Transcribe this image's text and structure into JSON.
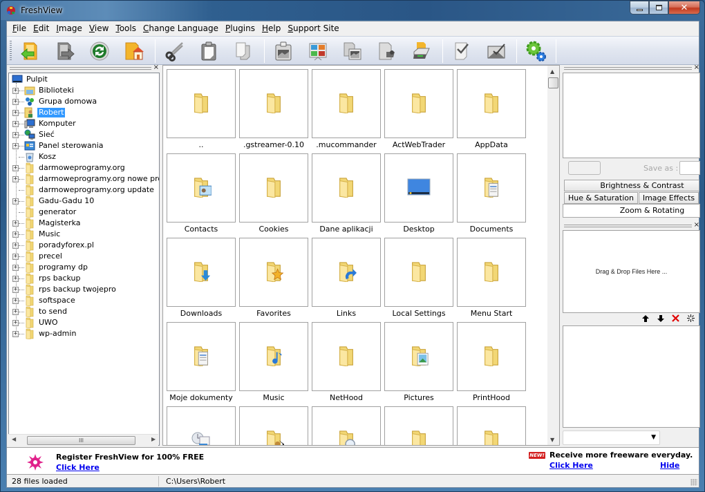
{
  "window": {
    "title": "FreshView",
    "caption_buttons": {
      "minimize": "minimize-icon",
      "maximize": "maximize-icon",
      "close": "close-icon"
    }
  },
  "menu": [
    {
      "label": "File",
      "accel": "F",
      "rest": "ile"
    },
    {
      "label": "Edit",
      "accel": "E",
      "rest": "dit"
    },
    {
      "label": "Image",
      "accel": "I",
      "rest": "mage"
    },
    {
      "label": "View",
      "accel": "V",
      "rest": "iew"
    },
    {
      "label": "Tools",
      "accel": "T",
      "rest": "ools"
    },
    {
      "label": "Change Language",
      "accel": "C",
      "rest": "hange Language"
    },
    {
      "label": "Plugins",
      "accel": "P",
      "rest": "lugins"
    },
    {
      "label": "Help",
      "accel": "H",
      "rest": "elp"
    },
    {
      "label": "Support Site",
      "accel": "S",
      "rest": "upport Site"
    }
  ],
  "toolbar": {
    "buttons": [
      {
        "name": "go-up-folder",
        "icon": "folder-back-icon"
      },
      {
        "name": "forward",
        "icon": "folder-forward-icon"
      },
      {
        "name": "refresh",
        "icon": "refresh-icon"
      },
      {
        "name": "home-folder",
        "icon": "home-folder-icon"
      },
      {
        "name": "cut",
        "icon": "scissors-icon"
      },
      {
        "name": "paste",
        "icon": "clipboard-icon"
      },
      {
        "name": "copy",
        "icon": "copy-icon"
      },
      {
        "name": "paste-image",
        "icon": "clipboard-image-icon"
      },
      {
        "name": "slideshow",
        "icon": "slideshow-icon"
      },
      {
        "name": "batch-convert",
        "icon": "images-stack-icon"
      },
      {
        "name": "scan",
        "icon": "scanner-icon"
      },
      {
        "name": "print",
        "icon": "printer-icon"
      },
      {
        "name": "select-all",
        "icon": "check-page-icon"
      },
      {
        "name": "email",
        "icon": "mail-check-icon"
      },
      {
        "name": "plugins",
        "icon": "gears-icon"
      }
    ]
  },
  "tree": {
    "root": {
      "label": "Pulpit",
      "icon": "desktop-icon"
    },
    "items": [
      {
        "label": "Biblioteki",
        "icon": "libraries-icon",
        "expandable": true,
        "selected": false
      },
      {
        "label": "Grupa domowa",
        "icon": "homegroup-icon",
        "expandable": true,
        "selected": false
      },
      {
        "label": "Robert",
        "icon": "user-folder-icon",
        "expandable": true,
        "selected": true
      },
      {
        "label": "Komputer",
        "icon": "computer-icon",
        "expandable": true,
        "selected": false
      },
      {
        "label": "Sieć",
        "icon": "network-icon",
        "expandable": true,
        "selected": false
      },
      {
        "label": "Panel sterowania",
        "icon": "control-panel-icon",
        "expandable": true,
        "selected": false
      },
      {
        "label": "Kosz",
        "icon": "recycle-bin-icon",
        "expandable": false,
        "selected": false
      },
      {
        "label": "darmoweprogramy.org",
        "icon": "folder-icon",
        "expandable": true,
        "selected": false
      },
      {
        "label": "darmoweprogramy.org nowe programy",
        "icon": "folder-icon",
        "expandable": true,
        "selected": false
      },
      {
        "label": "darmoweprogramy.org update",
        "icon": "folder-icon",
        "expandable": false,
        "selected": false
      },
      {
        "label": "Gadu-Gadu 10",
        "icon": "folder-icon",
        "expandable": true,
        "selected": false
      },
      {
        "label": "generator",
        "icon": "folder-icon",
        "expandable": false,
        "selected": false
      },
      {
        "label": "Magisterka",
        "icon": "folder-icon",
        "expandable": true,
        "selected": false
      },
      {
        "label": "Music",
        "icon": "folder-icon",
        "expandable": true,
        "selected": false
      },
      {
        "label": "poradyforex.pl",
        "icon": "folder-icon",
        "expandable": true,
        "selected": false
      },
      {
        "label": "precel",
        "icon": "folder-icon",
        "expandable": true,
        "selected": false
      },
      {
        "label": "programy dp",
        "icon": "folder-icon",
        "expandable": true,
        "selected": false
      },
      {
        "label": "rps backup",
        "icon": "folder-icon",
        "expandable": true,
        "selected": false
      },
      {
        "label": "rps backup twojepro",
        "icon": "folder-icon",
        "expandable": true,
        "selected": false
      },
      {
        "label": "softspace",
        "icon": "folder-icon",
        "expandable": true,
        "selected": false
      },
      {
        "label": "to send",
        "icon": "folder-icon",
        "expandable": true,
        "selected": false
      },
      {
        "label": "UWO",
        "icon": "folder-icon",
        "expandable": true,
        "selected": false
      },
      {
        "label": "wp-admin",
        "icon": "folder-icon",
        "expandable": true,
        "selected": false
      }
    ],
    "hscroll_thumb_glyph": "III"
  },
  "grid": {
    "items": [
      {
        "label": "..",
        "icon": "folder-icon"
      },
      {
        "label": ".gstreamer-0.10",
        "icon": "folder-icon"
      },
      {
        "label": ".mucommander",
        "icon": "folder-icon"
      },
      {
        "label": "ActWebTrader",
        "icon": "folder-icon"
      },
      {
        "label": "AppData",
        "icon": "folder-icon"
      },
      {
        "label": "Contacts",
        "icon": "contacts-folder-icon"
      },
      {
        "label": "Cookies",
        "icon": "folder-icon"
      },
      {
        "label": "Dane aplikacji",
        "icon": "folder-icon"
      },
      {
        "label": "Desktop",
        "icon": "desktop-icon"
      },
      {
        "label": "Documents",
        "icon": "documents-folder-icon"
      },
      {
        "label": "Downloads",
        "icon": "downloads-folder-icon"
      },
      {
        "label": "Favorites",
        "icon": "favorites-folder-icon"
      },
      {
        "label": "Links",
        "icon": "links-folder-icon"
      },
      {
        "label": "Local Settings",
        "icon": "folder-icon"
      },
      {
        "label": "Menu Start",
        "icon": "folder-icon"
      },
      {
        "label": "Moje dokumenty",
        "icon": "documents-folder-icon"
      },
      {
        "label": "Music",
        "icon": "music-folder-icon"
      },
      {
        "label": "NetHood",
        "icon": "folder-icon"
      },
      {
        "label": "Pictures",
        "icon": "pictures-folder-icon"
      },
      {
        "label": "PrintHood",
        "icon": "folder-icon"
      },
      {
        "label": "",
        "icon": "recent-items-icon"
      },
      {
        "label": "",
        "icon": "saved-games-folder-icon"
      },
      {
        "label": "",
        "icon": "searches-folder-icon"
      },
      {
        "label": "",
        "icon": "folder-icon"
      },
      {
        "label": "",
        "icon": "folder-icon"
      }
    ]
  },
  "right_panel": {
    "save_as_label": "Save as :",
    "save_as_value": "",
    "tabs": [
      {
        "label": "Brightness & Contrast",
        "active": false
      },
      {
        "label": "Hue & Saturation",
        "active": false
      },
      {
        "label": "Image Effects",
        "active": false
      },
      {
        "label": "Zoom & Rotating",
        "active": true
      }
    ],
    "drop_zone_text": "Drag & Drop Files Here ...",
    "list_tools": [
      {
        "name": "move-up",
        "icon": "arrow-up-icon",
        "glyph": "🡅"
      },
      {
        "name": "move-down",
        "icon": "arrow-down-icon",
        "glyph": "🡇"
      },
      {
        "name": "remove",
        "icon": "red-x-icon",
        "glyph": "✕"
      },
      {
        "name": "clear",
        "icon": "sparkle-icon",
        "glyph": "✳"
      }
    ],
    "combo_value": ""
  },
  "adbar": {
    "left_title": "Register FreshView for 100% FREE",
    "left_link": "Click Here",
    "badge": "NEW!",
    "right_title": "Receive more freeware everyday.",
    "right_link": "Click Here",
    "hide_link": "Hide"
  },
  "status": {
    "files_loaded": "28 files loaded",
    "path": "C:\\Users\\Robert"
  },
  "colors": {
    "selection": "#3399ff",
    "link": "#0000ee",
    "badge": "#d32020"
  }
}
